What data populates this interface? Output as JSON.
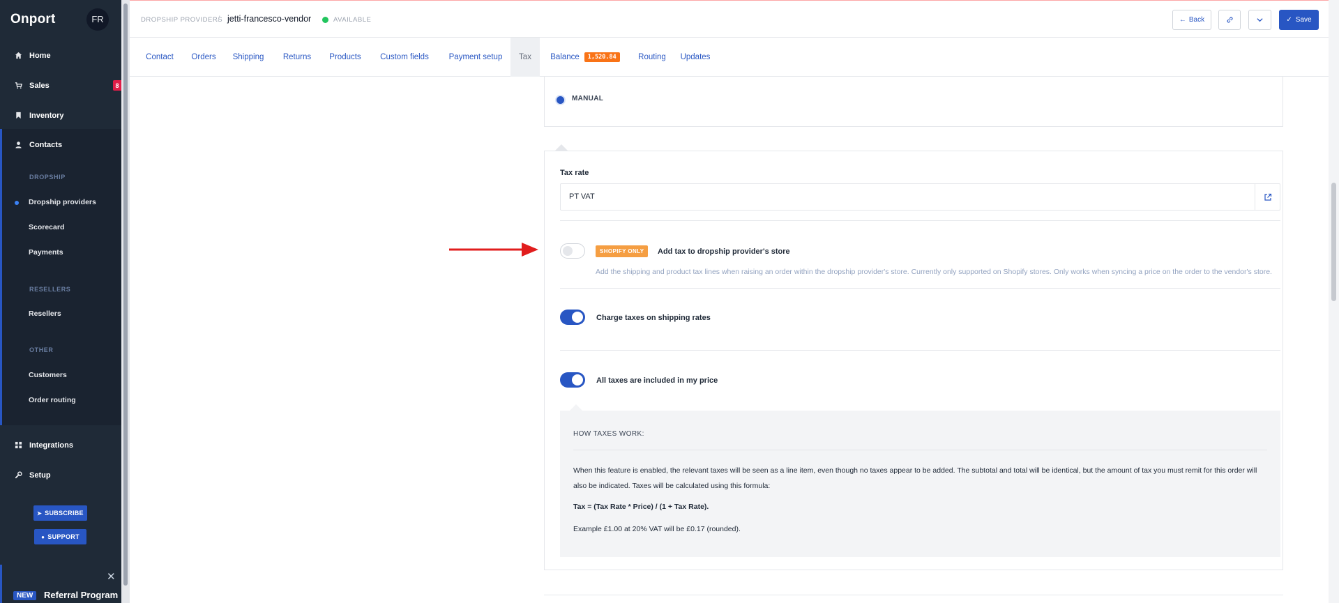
{
  "sidebar": {
    "logo": "Onport",
    "avatar_initials": "FR",
    "nav": [
      {
        "label": "Home",
        "icon": "home-icon"
      },
      {
        "label": "Sales",
        "icon": "cart-icon"
      },
      {
        "label": "Inventory",
        "icon": "bookmark-icon"
      },
      {
        "label": "Contacts",
        "icon": "user-icon"
      },
      {
        "label": "Integrations",
        "icon": "grid-icon"
      },
      {
        "label": "Setup",
        "icon": "wrench-icon"
      }
    ],
    "sales_badge": "8",
    "groups": [
      {
        "heading": "DROPSHIP",
        "items": [
          "Dropship providers",
          "Scorecard",
          "Payments"
        ]
      },
      {
        "heading": "RESELLERS",
        "items": [
          "Resellers"
        ]
      },
      {
        "heading": "OTHER",
        "items": [
          "Customers",
          "Order routing"
        ]
      }
    ],
    "subscribe_label": "SUBSCRIBE",
    "support_label": "SUPPORT",
    "referral_new": "NEW",
    "referral_label": "Referral Program"
  },
  "header": {
    "breadcrumb_parent": "DROPSHIP PROVIDERS",
    "breadcrumb_sep": "/",
    "vendor_name": "jetti-francesco-vendor",
    "status": "AVAILABLE",
    "back_label": "Back",
    "save_label": "Save"
  },
  "tabs": [
    {
      "label": "Contact"
    },
    {
      "label": "Orders"
    },
    {
      "label": "Shipping"
    },
    {
      "label": "Returns"
    },
    {
      "label": "Products"
    },
    {
      "label": "Custom fields"
    },
    {
      "label": "Payment setup"
    },
    {
      "label": "Tax",
      "active": true
    },
    {
      "label": "Balance",
      "badge": "1,520.84"
    },
    {
      "label": "Routing"
    },
    {
      "label": "Updates"
    }
  ],
  "tax": {
    "radio_label": "MANUAL",
    "tax_rate_label": "Tax rate",
    "tax_rate_value": "PT VAT",
    "toggles": [
      {
        "badge": "SHOPIFY ONLY",
        "title": "Add tax to dropship provider's store",
        "description": "Add the shipping and product tax lines when raising an order within the dropship provider's store. Currently only supported on Shopify stores. Only works when syncing a price on the order to the vendor's store.",
        "on": false
      },
      {
        "title": "Charge taxes on shipping rates",
        "on": true
      },
      {
        "title": "All taxes are included in my price",
        "on": true
      }
    ],
    "info": {
      "heading": "HOW TAXES WORK:",
      "paragraph": "When this feature is enabled, the relevant taxes will be seen as a line item, even though no taxes appear to be added. The subtotal and total will be identical, but the amount of tax you must remit for this order will also be indicated. Taxes will be calculated using this formula:",
      "formula": "Tax = (Tax Rate * Price) / (1 + Tax Rate).",
      "example": "Example £1.00 at 20% VAT will be £0.17 (rounded)."
    }
  },
  "colors": {
    "accent": "#2856c3",
    "sidebar_bg": "#1f2a37",
    "badge_orange": "#f97316",
    "status_green": "#22c55e",
    "arrow_red": "#e11d1d"
  }
}
